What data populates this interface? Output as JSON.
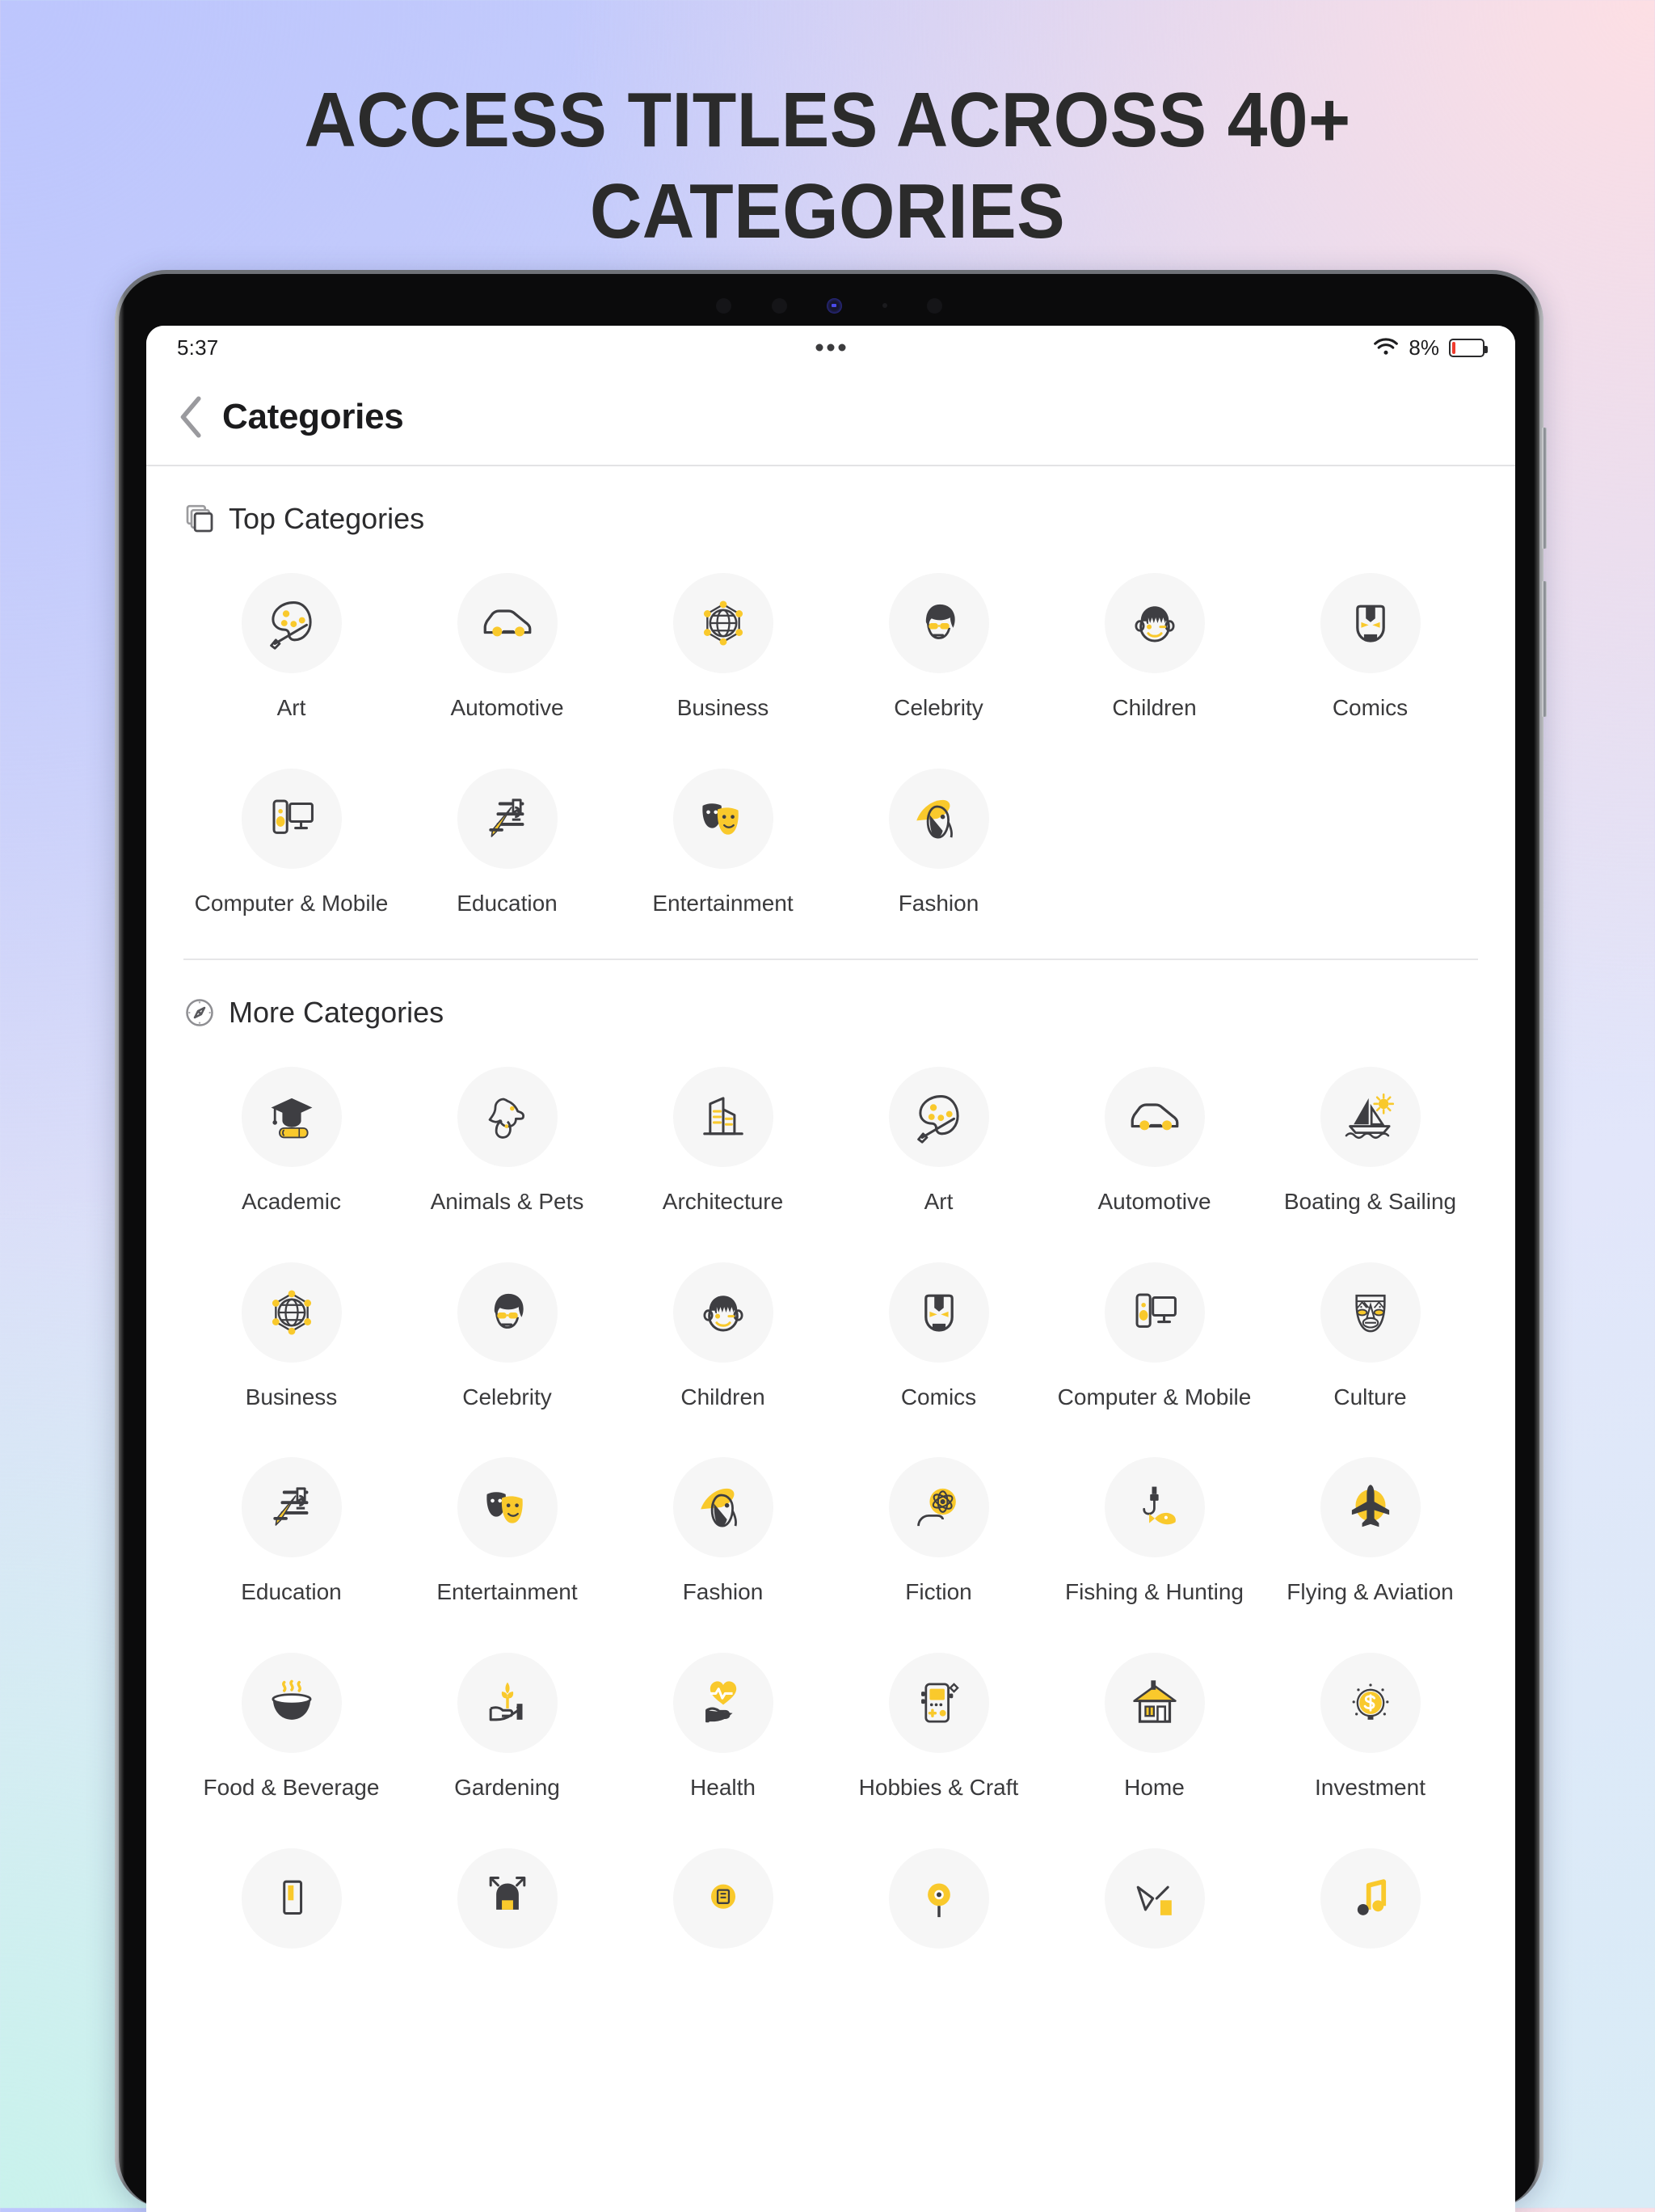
{
  "headline": "ACCESS TITLES ACROSS 40+\nCATEGORIES",
  "headline_line1": "ACCESS TITLES ACROSS 40+",
  "headline_line2": "CATEGORIES",
  "colors": {
    "accent_yellow": "#F9C92C",
    "icon_dark": "#3E3E42",
    "circle_bg": "#F6F6F6",
    "battery_low": "#EF3B2D",
    "bg_top_left": "#BDC6FD",
    "bg_top_right": "#FDDFE4",
    "bg_bottom_left": "#C9F2EC"
  },
  "status_bar": {
    "time": "5:37",
    "battery_percent": "8%",
    "wifi_icon": "wifi-icon",
    "dots_icon": "three-dots-icon",
    "battery_icon": "battery-low-icon"
  },
  "nav": {
    "back_icon": "back-chevron-icon",
    "title": "Categories"
  },
  "sections": [
    {
      "id": "top-categories",
      "icon": "stacked-squares-icon",
      "label": "Top Categories",
      "items": [
        {
          "label": "Art",
          "icon": "palette-icon"
        },
        {
          "label": "Automotive",
          "icon": "car-icon"
        },
        {
          "label": "Business",
          "icon": "globe-network-icon"
        },
        {
          "label": "Celebrity",
          "icon": "celebrity-face-icon"
        },
        {
          "label": "Children",
          "icon": "child-face-icon"
        },
        {
          "label": "Comics",
          "icon": "ironman-mask-icon"
        },
        {
          "label": "Computer & Mobile",
          "icon": "monitor-phone-icon"
        },
        {
          "label": "Education",
          "icon": "books-pencil-icon"
        },
        {
          "label": "Entertainment",
          "icon": "theatre-masks-icon"
        },
        {
          "label": "Fashion",
          "icon": "woman-hat-icon"
        }
      ]
    },
    {
      "id": "more-categories",
      "icon": "compass-icon",
      "label": "More Categories",
      "items": [
        {
          "label": "Academic",
          "icon": "graduation-cap-icon"
        },
        {
          "label": "Animals & Pets",
          "icon": "dog-cat-icon"
        },
        {
          "label": "Architecture",
          "icon": "buildings-icon"
        },
        {
          "label": "Art",
          "icon": "palette-icon"
        },
        {
          "label": "Automotive",
          "icon": "car-icon"
        },
        {
          "label": "Boating & Sailing",
          "icon": "sailboat-sun-icon"
        },
        {
          "label": "Business",
          "icon": "globe-network-icon"
        },
        {
          "label": "Celebrity",
          "icon": "celebrity-face-icon"
        },
        {
          "label": "Children",
          "icon": "child-face-icon"
        },
        {
          "label": "Comics",
          "icon": "ironman-mask-icon"
        },
        {
          "label": "Computer & Mobile",
          "icon": "monitor-phone-icon"
        },
        {
          "label": "Culture",
          "icon": "tribal-mask-icon"
        },
        {
          "label": "Education",
          "icon": "books-pencil-icon"
        },
        {
          "label": "Entertainment",
          "icon": "theatre-masks-icon"
        },
        {
          "label": "Fashion",
          "icon": "woman-hat-icon"
        },
        {
          "label": "Fiction",
          "icon": "hand-atom-icon"
        },
        {
          "label": "Fishing & Hunting",
          "icon": "fish-hook-icon"
        },
        {
          "label": "Flying & Aviation",
          "icon": "airplane-icon"
        },
        {
          "label": "Food & Beverage",
          "icon": "hot-bowl-icon"
        },
        {
          "label": "Gardening",
          "icon": "hand-plant-icon"
        },
        {
          "label": "Health",
          "icon": "hand-heartbeat-icon"
        },
        {
          "label": "Hobbies & Craft",
          "icon": "handheld-game-icon"
        },
        {
          "label": "Home",
          "icon": "house-icon"
        },
        {
          "label": "Investment",
          "icon": "dollar-coin-icon"
        },
        {
          "label": "",
          "icon": "book-partial-icon"
        },
        {
          "label": "",
          "icon": "arrows-partial-icon"
        },
        {
          "label": "",
          "icon": "news-partial-icon"
        },
        {
          "label": "",
          "icon": "eye-partial-icon"
        },
        {
          "label": "",
          "icon": "sports-partial-icon"
        },
        {
          "label": "",
          "icon": "music-partial-icon"
        }
      ]
    }
  ]
}
